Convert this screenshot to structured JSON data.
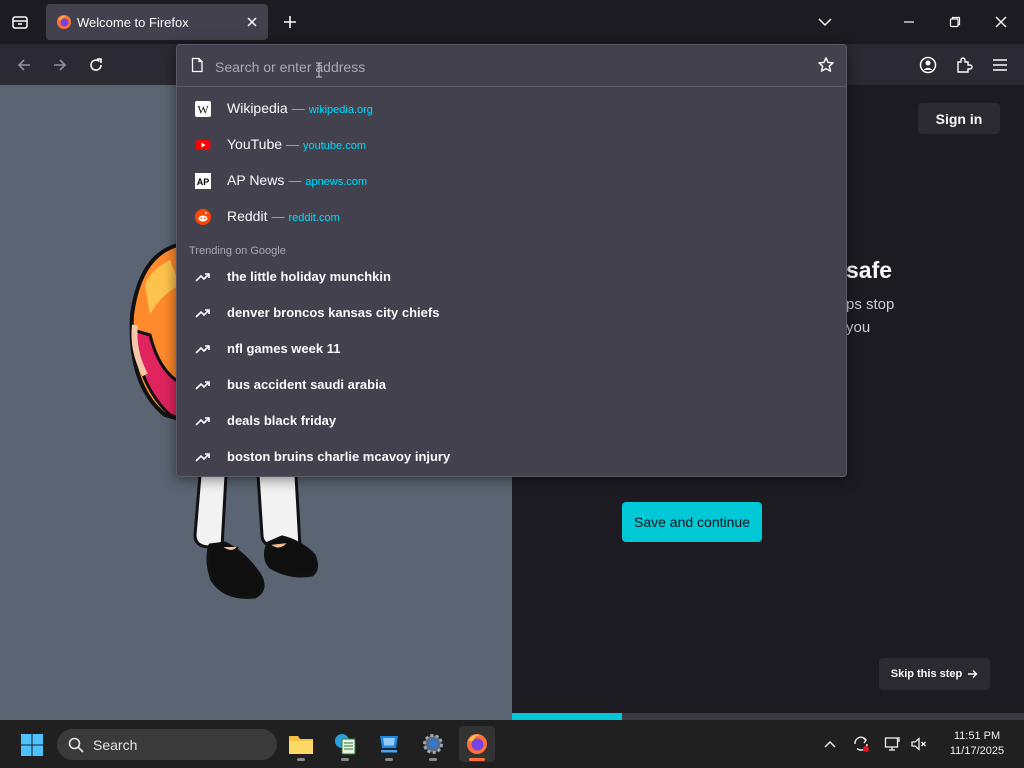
{
  "tab": {
    "title": "Welcome to Firefox"
  },
  "urlbar": {
    "placeholder": "Search or enter address",
    "shortcuts": [
      {
        "name": "Wikipedia",
        "site": "wikipedia.org",
        "icon": "wikipedia-icon"
      },
      {
        "name": "YouTube",
        "site": "youtube.com",
        "icon": "youtube-icon"
      },
      {
        "name": "AP News",
        "site": "apnews.com",
        "icon": "apnews-icon"
      },
      {
        "name": "Reddit",
        "site": "reddit.com",
        "icon": "reddit-icon"
      }
    ],
    "separator": "—",
    "trending_title": "Trending on Google",
    "trending": [
      "the little holiday munchkin",
      "denver broncos kansas city chiefs",
      "nfl games week 11",
      "bus accident saudi arabia",
      "deals black friday",
      "boston bruins charlie mcavoy injury"
    ]
  },
  "page": {
    "signin_label": "Sign in",
    "heading_fragment": "safe",
    "body_line_1": "ps stop",
    "body_line_2": "you",
    "save_label": "Save and continue",
    "skip_label": "Skip this step",
    "progress": 0.215
  },
  "taskbar": {
    "search_label": "Search",
    "time": "11:51 PM",
    "date": "11/17/2025"
  },
  "colors": {
    "accent": "#00c8d7",
    "link": "#00ddff",
    "panel": "#42414d",
    "toolbar": "#2b2a33",
    "chrome": "#1c1b22"
  }
}
